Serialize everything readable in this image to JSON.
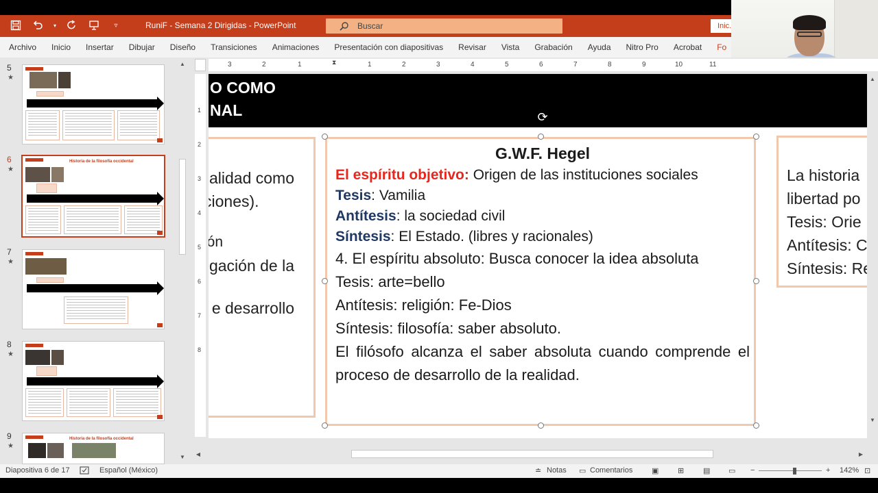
{
  "window": {
    "title": "RuniF - Semana 2 Dirigidas  -  PowerPoint",
    "search_placeholder": "Buscar",
    "signin_label": "Inic..."
  },
  "menu": [
    "Archivo",
    "Inicio",
    "Insertar",
    "Dibujar",
    "Diseño",
    "Transiciones",
    "Animaciones",
    "Presentación con diapositivas",
    "Revisar",
    "Vista",
    "Grabación",
    "Ayuda",
    "Nitro Pro",
    "Acrobat",
    "Fo"
  ],
  "thumbnails": [
    {
      "number": "5",
      "title": ""
    },
    {
      "number": "6",
      "title": "Historia de la filosofía occidental"
    },
    {
      "number": "7",
      "title": ""
    },
    {
      "number": "8",
      "title": ""
    },
    {
      "number": "9",
      "title": "Historia de la filosofía occidental"
    }
  ],
  "ruler": {
    "h_ticks": [
      "3",
      "2",
      "1",
      "1",
      "2",
      "3",
      "4",
      "5",
      "6",
      "7",
      "8",
      "9",
      "10",
      "11"
    ],
    "v_ticks": [
      "1",
      "2",
      "3",
      "4",
      "5",
      "6",
      "7",
      "8"
    ]
  },
  "slide": {
    "header_line1": "O COMO",
    "header_line2": "NAL",
    "left_panel": [
      "alidad como",
      "ciones).",
      "",
      "ión",
      "gación de la",
      "",
      "e desarrollo",
      ":"
    ],
    "right_panel": [
      "La  historia",
      "libertad po",
      "Tesis: Orie",
      "Antítesis: C",
      "Síntesis: Re"
    ],
    "main": {
      "heading": "G.W.F. Hegel",
      "objective_label": "El espíritu objetivo:",
      "objective_text": " Origen de las instituciones sociales",
      "tesis_label": "Tesis",
      "tesis_text": ": Vamilia",
      "antitesis_label": "Antítesis",
      "antitesis_text": ": la sociedad civil",
      "sintesis_label": "Síntesis",
      "sintesis_text": ": El Estado. (libres y racionales)",
      "absolute": "4. El espíritu absoluto: Busca conocer la idea absoluta",
      "line_tesis": "Tesis: arte=bello",
      "line_antitesis": "Antítesis: religión: Fe-Dios",
      "line_sintesis": "Síntesis: filosofía: saber absoluto.",
      "conclusion": "El filósofo alcanza el saber absoluta cuando comprende el proceso de desarrollo de la realidad."
    }
  },
  "status": {
    "slide_info": "Diapositiva 6 de 17",
    "language": "Español (México)",
    "notes": "Notas",
    "comments": "Comentarios",
    "zoom": "142%"
  },
  "colors": {
    "accent": "#c43e1c",
    "red_text": "#e8261c",
    "navy_text": "#1f3864",
    "panel_border": "#f2c8ad"
  }
}
